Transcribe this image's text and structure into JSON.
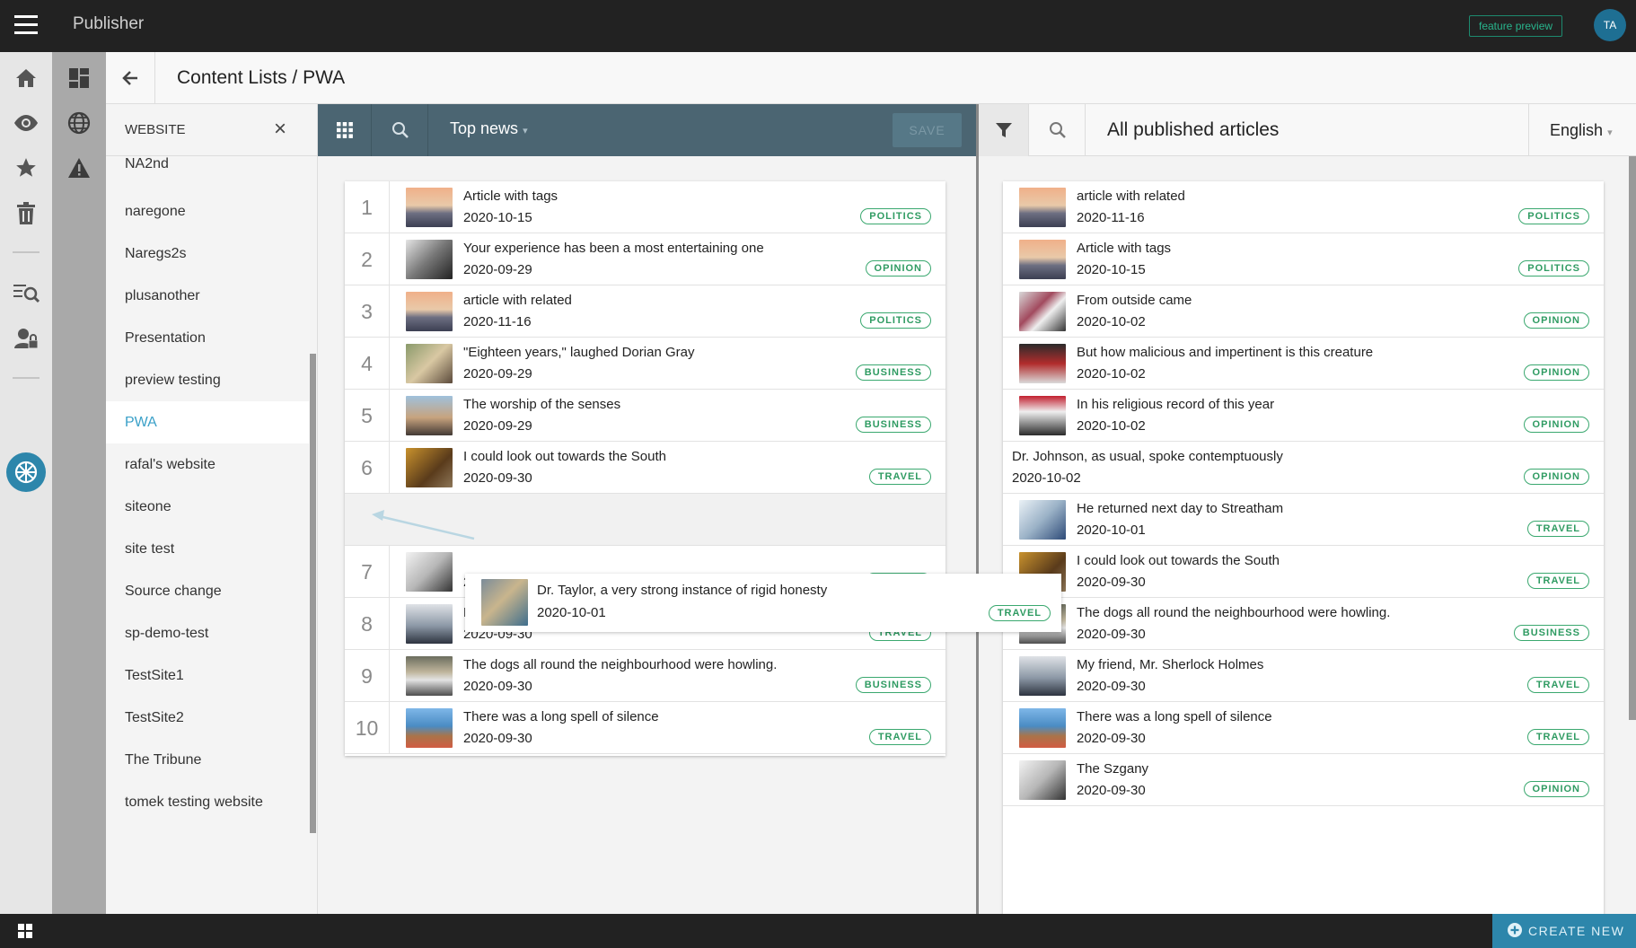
{
  "app": {
    "name": "Publisher",
    "feature_preview": "feature preview",
    "avatar_initials": "TA"
  },
  "header": {
    "title": "Content Lists / PWA"
  },
  "sites": {
    "heading": "WEBSITE",
    "close": "×",
    "items": [
      "NA2nd",
      "naregone",
      "Naregs2s",
      "plusanother",
      "Presentation",
      "preview testing",
      "PWA",
      "rafal's website",
      "siteone",
      "site test",
      "Source change",
      "sp-demo-test",
      "TestSite1",
      "TestSite2",
      "The Tribune",
      "tomek testing website"
    ],
    "active_index": 6
  },
  "list": {
    "title": "Top news",
    "caret": "▾",
    "save_label": "SAVE",
    "rows": [
      {
        "num": "1",
        "title": "Article with tags",
        "date": "2020-10-15",
        "tag": "POLITICS"
      },
      {
        "num": "2",
        "title": "Your experience has been a most entertaining one",
        "date": "2020-09-29",
        "tag": "OPINION"
      },
      {
        "num": "3",
        "title": "article with related",
        "date": "2020-11-16",
        "tag": "POLITICS"
      },
      {
        "num": "4",
        "title": "\"Eighteen years,\" laughed Dorian Gray",
        "date": "2020-09-29",
        "tag": "BUSINESS"
      },
      {
        "num": "5",
        "title": "The worship of the senses",
        "date": "2020-09-29",
        "tag": "BUSINESS"
      },
      {
        "num": "6",
        "title": "I could look out towards the South",
        "date": "2020-09-30",
        "tag": "TRAVEL"
      },
      {
        "num": "7",
        "title": "",
        "date": "2020-09-30",
        "tag": "OPINION"
      },
      {
        "num": "8",
        "title": "My friend, Mr. Sherlock Holmes",
        "date": "2020-09-30",
        "tag": "TRAVEL"
      },
      {
        "num": "9",
        "title": "The dogs all round the neighbourhood were howling.",
        "date": "2020-09-30",
        "tag": "BUSINESS"
      },
      {
        "num": "10",
        "title": "There was a long spell of silence",
        "date": "2020-09-30",
        "tag": "TRAVEL"
      }
    ],
    "dragging": {
      "title": "Dr. Taylor, a very strong instance of rigid honesty",
      "date": "2020-10-01",
      "tag": "TRAVEL"
    }
  },
  "published": {
    "title": "All published articles",
    "language": "English",
    "caret": "▾",
    "rows": [
      {
        "title": "article with related",
        "date": "2020-11-16",
        "tag": "POLITICS",
        "thumb": true
      },
      {
        "title": "Article with tags",
        "date": "2020-10-15",
        "tag": "POLITICS",
        "thumb": true
      },
      {
        "title": "From outside came",
        "date": "2020-10-02",
        "tag": "OPINION",
        "thumb": true
      },
      {
        "title": "But how malicious and impertinent is this creature",
        "date": "2020-10-02",
        "tag": "OPINION",
        "thumb": true
      },
      {
        "title": "In his religious record of this year",
        "date": "2020-10-02",
        "tag": "OPINION",
        "thumb": true
      },
      {
        "title": "Dr. Johnson, as usual, spoke contemptuously",
        "date": "2020-10-02",
        "tag": "OPINION",
        "thumb": false
      },
      {
        "title": "He returned next day to Streatham",
        "date": "2020-10-01",
        "tag": "TRAVEL",
        "thumb": true
      },
      {
        "title": "I could look out towards the South",
        "date": "2020-09-30",
        "tag": "TRAVEL",
        "thumb": true
      },
      {
        "title": "The dogs all round the neighbourhood were howling.",
        "date": "2020-09-30",
        "tag": "BUSINESS",
        "thumb": true
      },
      {
        "title": "My friend, Mr. Sherlock Holmes",
        "date": "2020-09-30",
        "tag": "TRAVEL",
        "thumb": true
      },
      {
        "title": "There was a long spell of silence",
        "date": "2020-09-30",
        "tag": "TRAVEL",
        "thumb": true
      },
      {
        "title": "The Szgany",
        "date": "2020-09-30",
        "tag": "OPINION",
        "thumb": true
      }
    ]
  },
  "footer": {
    "create_new": "CREATE NEW"
  },
  "colors": {
    "accent": "#2d86ab",
    "toolbar": "#4b6572",
    "tag_green": "#2f9b62",
    "active_site": "#3aa0c8"
  },
  "icons": [
    "hamburger-icon",
    "home-icon",
    "eye-icon",
    "star-icon",
    "trash-icon",
    "search-list-icon",
    "user-lock-icon",
    "globe-icon",
    "dashboard-icon",
    "warning-icon",
    "back-arrow-icon",
    "grid-icon",
    "search-icon",
    "filter-icon",
    "windows-icon",
    "plus-circle-icon"
  ]
}
